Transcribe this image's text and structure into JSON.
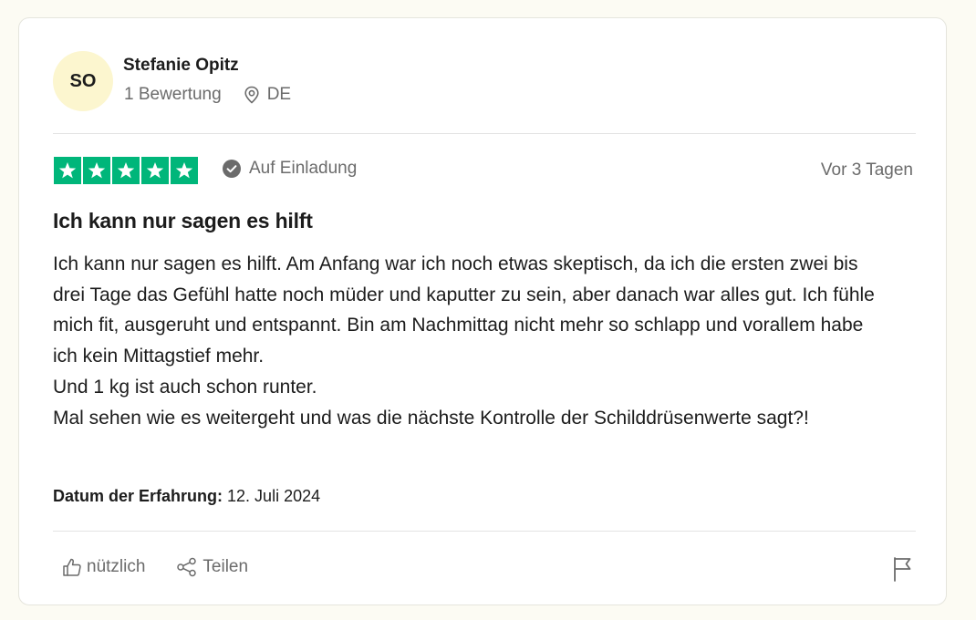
{
  "reviewer": {
    "initials": "SO",
    "name": "Stefanie Opitz",
    "review_count": "1 Bewertung",
    "country": "DE"
  },
  "review": {
    "rating": 5,
    "rating_max": 5,
    "invited_label": "Auf Einladung",
    "posted_ago": "Vor 3 Tagen",
    "title": "Ich kann nur sagen es hilft",
    "body_lines": [
      "Ich kann nur sagen es hilft. Am Anfang war ich noch etwas skeptisch, da ich die ersten zwei bis drei Tage das Gefühl hatte noch müder und kaputter zu sein, aber danach war alles gut. Ich fühle mich fit, ausgeruht und entspannt. Bin am Nachmittag nicht mehr so schlapp und vorallem habe ich kein Mittagstief mehr.",
      "Und 1 kg ist auch schon runter.",
      "Mal sehen wie es weitergeht und was die nächste Kontrolle der Schilddrüsenwerte sagt?!"
    ],
    "experience_label": "Datum der Erfahrung:",
    "experience_date": "12. Juli 2024"
  },
  "actions": {
    "useful_label": "nützlich",
    "share_label": "Teilen"
  },
  "colors": {
    "star_green": "#00b67a",
    "avatar_bg": "#fcf6cf",
    "muted_text": "#6b6b6b"
  },
  "icons": [
    "location-pin-icon",
    "star-icon",
    "check-circle-icon",
    "thumbs-up-icon",
    "share-icon",
    "flag-icon"
  ]
}
